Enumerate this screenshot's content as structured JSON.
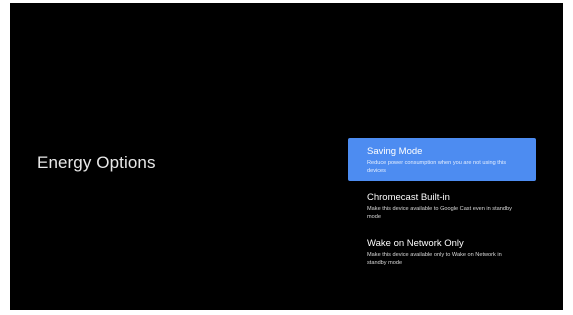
{
  "page": {
    "title": "Energy Options"
  },
  "colors": {
    "background": "#000000",
    "accent": "#4d8cf1",
    "text": "#e8e8e8"
  },
  "options": [
    {
      "title": "Saving Mode",
      "description": "Reduce power consumption when you are not using this devices",
      "selected": true
    },
    {
      "title": "Chromecast Built-in",
      "description": "Make this device available to Google Cast even in standby mode",
      "selected": false
    },
    {
      "title": "Wake on Network Only",
      "description": "Make this device available only to Wake on Network in standby mode",
      "selected": false
    }
  ]
}
